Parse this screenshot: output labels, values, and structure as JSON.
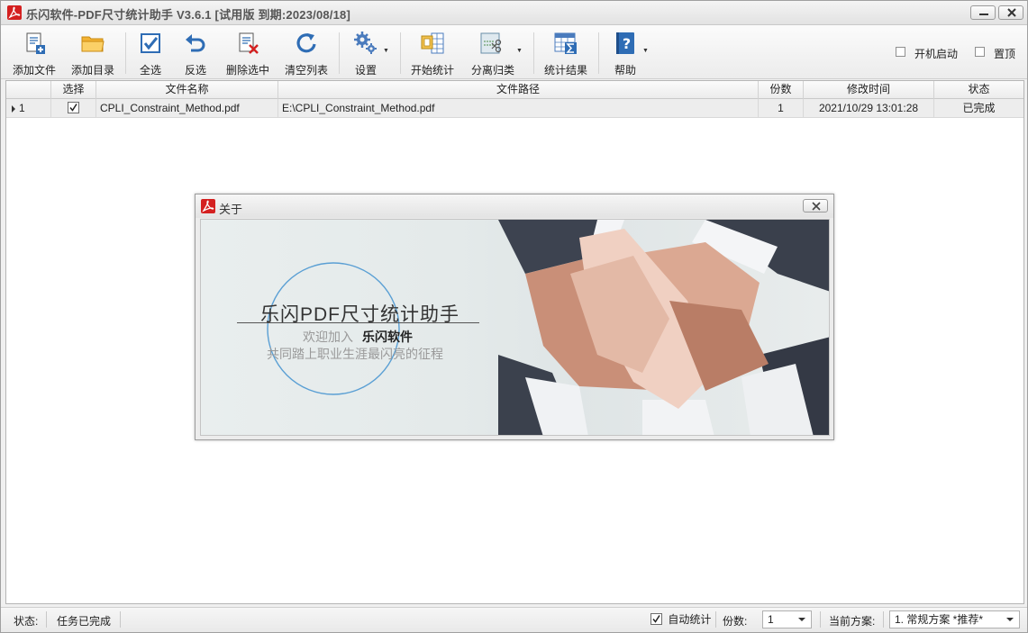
{
  "window": {
    "title": "乐闪软件-PDF尺寸统计助手 V3.6.1 [试用版 到期:2023/08/18]"
  },
  "toolbar": {
    "add_file": "添加文件",
    "add_dir": "添加目录",
    "select_all": "全选",
    "invert": "反选",
    "delete_selected": "删除选中",
    "clear_list": "清空列表",
    "settings": "设置",
    "start_stats": "开始统计",
    "split_classify": "分离归类",
    "stats_result": "统计结果",
    "help": "帮助",
    "autostart": "开机启动",
    "pin_top": "置顶"
  },
  "grid": {
    "columns": [
      "选择",
      "文件名称",
      "文件路径",
      "份数",
      "修改时间",
      "状态"
    ],
    "rows": [
      {
        "index": "1",
        "selected": true,
        "name": "CPLI_Constraint_Method.pdf",
        "path": "E:\\CPLI_Constraint_Method.pdf",
        "copies": "1",
        "modified": "2021/10/29 13:01:28",
        "status": "已完成"
      }
    ]
  },
  "dialog": {
    "title": "关于",
    "banner_title": "乐闪PDF尺寸统计助手",
    "welcome": "欢迎加入",
    "brand": "乐闪软件",
    "slogan": "共同踏上职业生涯最闪亮的征程"
  },
  "statusbar": {
    "status_label": "状态:",
    "status_text": "任务已完成",
    "auto_stats": "自动统计",
    "copies_label": "份数:",
    "copies_value": "1",
    "scheme_label": "当前方案:",
    "scheme_value": "1. 常规方案  *推荐*"
  },
  "colors": {
    "accent_blue": "#2f6db5",
    "pdf_red": "#d42020",
    "toolbar_bg": "#f0f0f0"
  }
}
